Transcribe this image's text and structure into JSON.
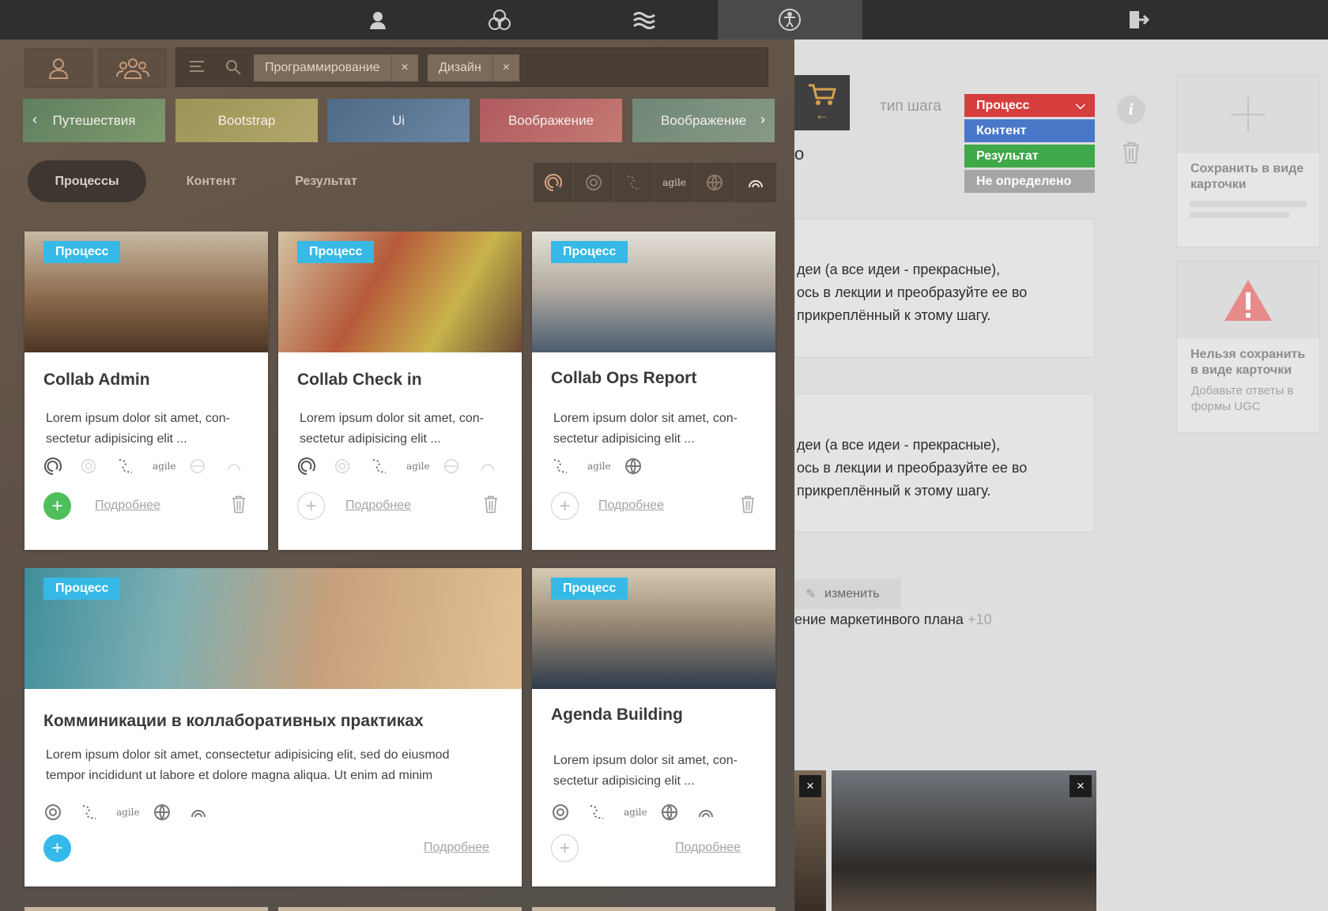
{
  "nav": {
    "items": [
      "user-avatar-icon",
      "circles-icon",
      "waves-icon",
      "accessibility-icon"
    ],
    "active": "accessibility-icon",
    "logout": "exit-icon"
  },
  "editor": {
    "step_type_label": "тип шага",
    "step_options": [
      {
        "label": "Процесс",
        "color": "#d63d3d"
      },
      {
        "label": "Контент",
        "color": "#4a78c9"
      },
      {
        "label": "Результат",
        "color": "#3fa848"
      },
      {
        "label": "Не определено",
        "color": "#a6a6a6"
      }
    ],
    "info": "i",
    "fragment_o": "o",
    "text1": [
      "деи (а все идеи - прекрасные),",
      "ось в лекции и преобразуйте ее во",
      "прикреплённый к этому шагу."
    ],
    "text2": [
      "деи (а все идеи - прекрасные),",
      "ось в лекции и преобразуйте ее во",
      "прикреплённый к этому шагу."
    ],
    "edit_label": "изменить",
    "plan_text": "ение маркетинвого плана",
    "plan_plus": "+10",
    "save_card": {
      "title": "Сохранить в виде карточки"
    },
    "cannot_save": {
      "title": "Нельзя сохранить в виде карточки",
      "sub": "Добавьте ответы в формы UGC"
    },
    "close": "×"
  },
  "panel": {
    "chips": [
      {
        "label": "Программирование"
      },
      {
        "label": "Дизайн"
      }
    ],
    "chip_close": "×",
    "categories": [
      {
        "label": "Путешествия",
        "bg": "linear-gradient(135deg,#5f7f5f,#7f9a6d)"
      },
      {
        "label": "Bootstrap",
        "bg": "linear-gradient(135deg,#9d9457,#b3a66a)"
      },
      {
        "label": "Ui",
        "bg": "linear-gradient(135deg,#4f6a86,#6a86a4)"
      },
      {
        "label": "Воображение",
        "bg": "linear-gradient(135deg,#b05a5f,#c57a73)"
      },
      {
        "label": "Воображение",
        "bg": "linear-gradient(135deg,#6f8777,#899a86)"
      }
    ],
    "arrow_left": "‹",
    "arrow_right": "›",
    "tabs": [
      {
        "label": "Процессы"
      },
      {
        "label": "Контент"
      },
      {
        "label": "Результат"
      }
    ],
    "filter_icons": [
      "spiral-icon",
      "swirl-icon",
      "dotted-path-icon",
      "agile-icon",
      "globe-icon",
      "rings-icon"
    ],
    "agile_text": "agile"
  },
  "cards": [
    {
      "badge": "Процесс",
      "title": "Collab Admin",
      "desc": [
        "Lorem ipsum dolor sit amet, con-",
        "sectetur adipisicing elit ..."
      ],
      "more": "Подробнее",
      "img": "linear-gradient(180deg,#c9b9a3 0%,#8a6a4c 55%,#4b3524 100%)",
      "plus": "green"
    },
    {
      "badge": "Процесс",
      "title": "Collab Check in",
      "desc": [
        "Lorem ipsum dolor sit amet, con-",
        "sectetur adipisicing elit ..."
      ],
      "more": "Подробнее",
      "img": "linear-gradient(120deg,#d2c3a2 0%,#b65a3a 40%,#c9b34c 70%,#6a4a34 100%)",
      "plus": "outline"
    },
    {
      "badge": "Процесс",
      "title": "Collab Ops Report",
      "desc": [
        "Lorem ipsum dolor sit amet, con-",
        "sectetur adipisicing elit ..."
      ],
      "more": "Подробнее",
      "img": "linear-gradient(180deg,#e5e0d8 0%,#b6aea3 45%,#4b5c6f 100%)",
      "plus": "outline"
    },
    {
      "badge": "Процесс",
      "title": "Комминикации в коллаборативных практиках",
      "desc": [
        "Lorem ipsum dolor sit amet, consectetur adipisicing elit, sed do eiusmod",
        "tempor incididunt ut labore et dolore magna aliqua. Ut enim ad minim"
      ],
      "more": "Подробнее",
      "img": "linear-gradient(100deg,#3f8e9c 0%,#7fb0b3 30%,#c7a07c 60%,#e2c294 100%)",
      "plus": "blue"
    },
    {
      "badge": "Процесс",
      "title": "Agenda Building",
      "desc": [
        "Lorem ipsum dolor sit amet, con-",
        "sectetur adipisicing elit ..."
      ],
      "more": "Подробнее",
      "img": "linear-gradient(180deg,#d7cbb6 0%,#9a8a75 45%,#2f3b4b 100%)",
      "plus": "outline"
    }
  ]
}
